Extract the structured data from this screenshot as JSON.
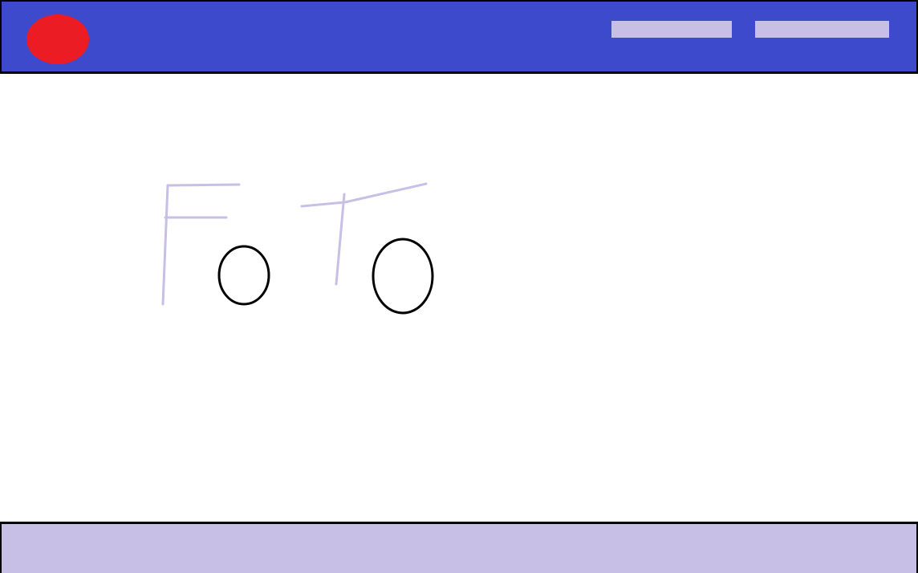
{
  "colors": {
    "header_bg": "#3d4acb",
    "logo": "#ec1c24",
    "nav_link": "#c8bfe7",
    "sketch_letters": "#c8bfe7",
    "sketch_circles": "#000000",
    "footer_bg": "#c8bfe7"
  },
  "header": {
    "logo_icon": "red-circle-logo",
    "nav_links": [
      "",
      ""
    ]
  },
  "main": {
    "sketch_icon": "hand-drawn-foto-sketch"
  },
  "footer": {}
}
